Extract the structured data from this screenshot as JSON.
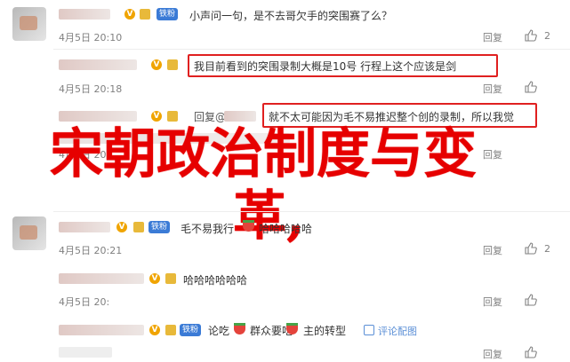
{
  "badge_label": "铁粉",
  "comments": [
    {
      "text": "小声问一句，是不去哥欠手的突围赛了么？",
      "date": "4月5日 20:10",
      "reply": "回复",
      "likes": "2"
    },
    {
      "text": "我目前看到的突围录制大概是10号 行程上这个应该是剑",
      "date": "4月5日 20:18",
      "reply": "回复"
    },
    {
      "prefix": "回复@",
      "text": "就不太可能因为毛不易推迟整个创的录制，所以我觉",
      "date": "4月5日 20:",
      "reply": "回复"
    },
    {
      "text": "毛不易我行",
      "suffix": "哈哈哈哈哈",
      "date": "4月5日 20:21",
      "reply": "回复",
      "likes": "2"
    },
    {
      "text": "哈哈哈哈哈哈",
      "date": "4月5日 20:",
      "reply": "回复"
    },
    {
      "text1": "论吃",
      "text2": "群众要吃",
      "text3": "主的转型",
      "comment_link": "评论配图",
      "reply": "回复"
    }
  ],
  "overlay": {
    "line1": "宋朝政治制度与变",
    "line2": "革,"
  },
  "colors": {
    "highlight": "#e02020",
    "overlay": "#e60000",
    "meta": "#808080"
  }
}
